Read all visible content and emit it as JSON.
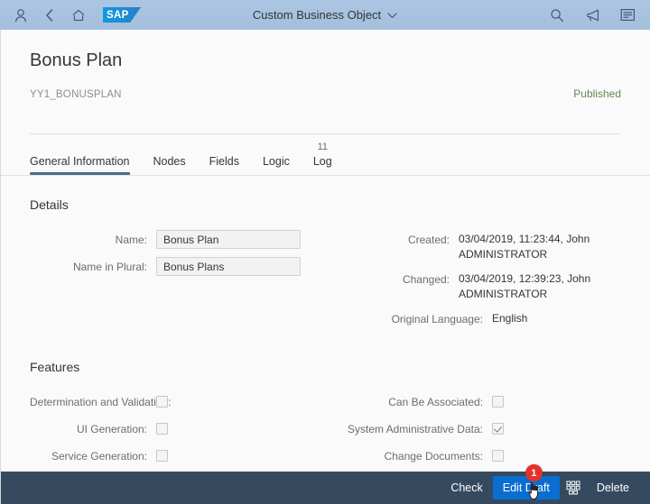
{
  "shellbar": {
    "title": "Custom Business Object",
    "icons": {
      "user": "user-icon",
      "back": "back-icon",
      "home": "home-icon",
      "logo": "sap-logo",
      "logo_text": "SAP",
      "search": "search-icon",
      "notifications": "megaphone-icon",
      "overflow": "list-icon",
      "title_chevron": "chevron-down-icon"
    }
  },
  "object_header": {
    "title": "Bonus Plan",
    "subtitle": "YY1_BONUSPLAN",
    "status": "Published",
    "status_color": "#5d8a4e"
  },
  "tabs": [
    {
      "label": "General Information",
      "count": "",
      "active": true
    },
    {
      "label": "Nodes",
      "count": "",
      "active": false
    },
    {
      "label": "Fields",
      "count": "",
      "active": false
    },
    {
      "label": "Logic",
      "count": "",
      "active": false
    },
    {
      "label": "Log",
      "count": "11",
      "active": false
    }
  ],
  "details": {
    "section_title": "Details",
    "left_fields": [
      {
        "label": "Name:",
        "value": "Bonus Plan"
      },
      {
        "label": "Name in Plural:",
        "value": "Bonus Plans"
      }
    ],
    "right_fields": [
      {
        "label": "Created:",
        "value": "03/04/2019, 11:23:44, John ADMINISTRATOR"
      },
      {
        "label": "Changed:",
        "value": "03/04/2019, 12:39:23, John ADMINISTRATOR"
      },
      {
        "label": "Original Language:",
        "value": "English"
      }
    ]
  },
  "features": {
    "section_title": "Features",
    "left_items": [
      {
        "label": "Determination and Validation:",
        "checked": false
      },
      {
        "label": "UI Generation:",
        "checked": false
      },
      {
        "label": "Service Generation:",
        "checked": false
      }
    ],
    "right_items": [
      {
        "label": "Can Be Associated:",
        "checked": false
      },
      {
        "label": "System Administrative Data:",
        "checked": true
      },
      {
        "label": "Change Documents:",
        "checked": false
      }
    ]
  },
  "footer": {
    "check_label": "Check",
    "edit_draft_label": "Edit Draft",
    "grid_icon": "grid-icon",
    "delete_label": "Delete",
    "badge_number": "1",
    "accent_color": "#0a6ed1",
    "bar_color": "#354a5f",
    "badge_color": "#e4322b"
  }
}
